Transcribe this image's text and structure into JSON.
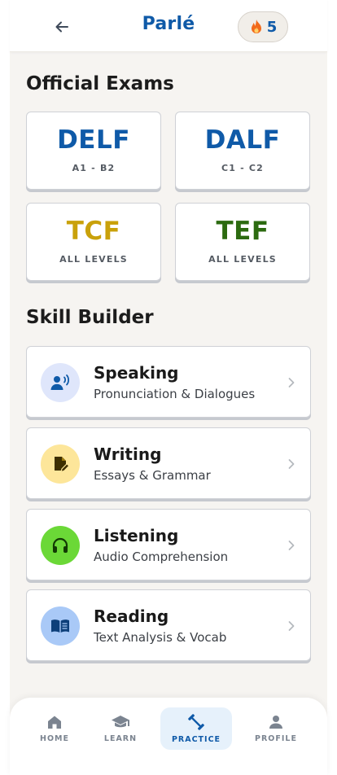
{
  "header": {
    "title": "Parlé",
    "streak_count": "5",
    "back_icon": "arrow-left-icon",
    "streak_icon": "flame-icon"
  },
  "exams": {
    "section_title": "Official Exams",
    "items": [
      {
        "name": "DELF",
        "level": "A1 - B2",
        "color": "#0f5aa8"
      },
      {
        "name": "DALF",
        "level": "C1 - C2",
        "color": "#0f5aa8"
      },
      {
        "name": "TCF",
        "level": "ALL LEVELS",
        "color": "#c9a10a"
      },
      {
        "name": "TEF",
        "level": "ALL LEVELS",
        "color": "#2c6a10"
      }
    ]
  },
  "skills": {
    "section_title": "Skill Builder",
    "items": [
      {
        "title": "Speaking",
        "subtitle": "Pronunciation & Dialogues",
        "icon": "speaking-icon",
        "bg": "#dfe6fb"
      },
      {
        "title": "Writing",
        "subtitle": "Essays & Grammar",
        "icon": "writing-icon",
        "bg": "#fde69a"
      },
      {
        "title": "Listening",
        "subtitle": "Audio Comprehension",
        "icon": "headphones-icon",
        "bg": "#6bd837"
      },
      {
        "title": "Reading",
        "subtitle": "Text Analysis & Vocab",
        "icon": "book-icon",
        "bg": "#a9c9f7"
      }
    ]
  },
  "nav": {
    "items": [
      {
        "label": "HOME",
        "icon": "home-icon"
      },
      {
        "label": "LEARN",
        "icon": "graduation-cap-icon"
      },
      {
        "label": "PRACTICE",
        "icon": "dumbbell-icon",
        "active": true
      },
      {
        "label": "PROFILE",
        "icon": "person-icon"
      }
    ]
  },
  "colors": {
    "primary": "#0f5aa8",
    "background": "#f6f4f1",
    "streak_flame": "#f26a1b"
  }
}
